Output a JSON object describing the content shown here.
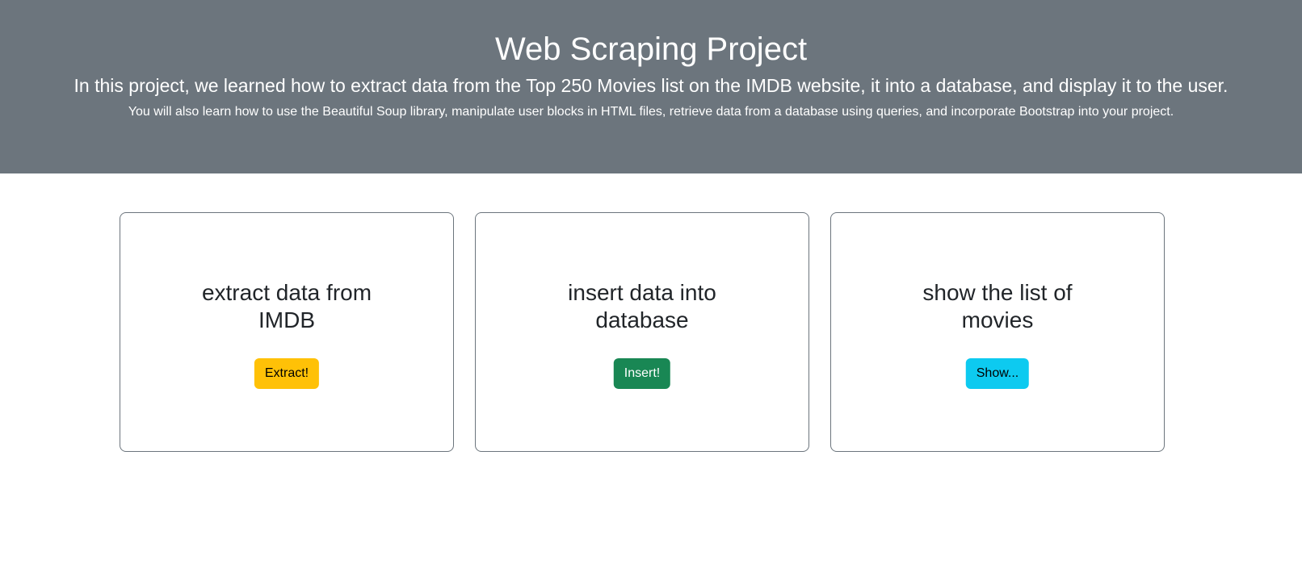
{
  "header": {
    "title": "Web Scraping Project",
    "lead": "In this project, we learned how to extract data from the Top 250 Movies list on the IMDB website, it into a database, and display it to the user.",
    "subtext": "You will also learn how to use the Beautiful Soup library, manipulate user blocks in HTML files, retrieve data from a database using queries, and incorporate Bootstrap into your project."
  },
  "cards": [
    {
      "title": "extract data from IMDB",
      "button_label": "Extract!",
      "button_color": "#ffc107"
    },
    {
      "title": "insert data into database",
      "button_label": "Insert!",
      "button_color": "#198754"
    },
    {
      "title": "show the list of movies",
      "button_label": "Show...",
      "button_color": "#0dcaf0"
    }
  ],
  "colors": {
    "header_bg": "#6c757d",
    "header_text": "#ffffff",
    "card_border": "#6c757d"
  }
}
